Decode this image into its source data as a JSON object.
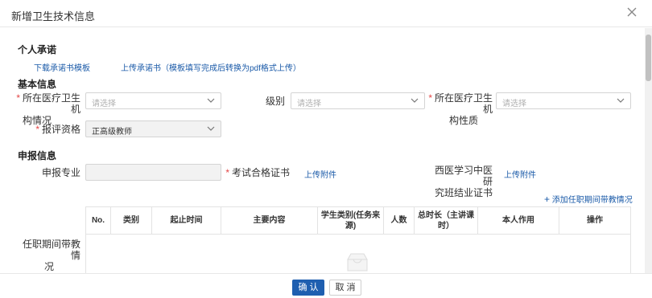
{
  "dialog": {
    "title": "新增卫生技术信息"
  },
  "personal": {
    "section": "个人承诺",
    "download_link": "下载承诺书模板",
    "upload_link": "上传承诺书（模板填写完成后转换为pdf格式上传）"
  },
  "basic": {
    "section": "基本信息",
    "institution_status": {
      "label_line1": "所在医疗卫生机",
      "label_line2": "构情况",
      "placeholder": "请选择"
    },
    "level": {
      "label": "级别",
      "placeholder": "请选择"
    },
    "institution_nature": {
      "label_line1": "所在医疗卫生机",
      "label_line2": "构性质",
      "placeholder": "请选择"
    },
    "qualification": {
      "label": "报评资格",
      "value": "正高级教师"
    }
  },
  "application": {
    "section": "申报信息",
    "major": {
      "label": "申报专业"
    },
    "exam_cert": {
      "label": "考试合格证书",
      "upload": "上传附件"
    },
    "western_cert": {
      "label_line1": "西医学习中医研",
      "label_line2": "究班结业证书",
      "upload": "上传附件"
    },
    "teaching": {
      "add_link": "添加任职期间带教情况",
      "label_line1": "任职期间带教情",
      "label_line2": "况",
      "columns": [
        "No.",
        "类别",
        "起止时间",
        "主要内容",
        "学生类别(任务来源)",
        "人数",
        "总时长（主讲课时）",
        "本人作用",
        "操作"
      ]
    }
  },
  "footer": {
    "confirm": "确 认",
    "cancel": "取 消"
  },
  "colors": {
    "primary": "#1f5fb0",
    "link": "#1a5aa8",
    "required": "#e34545"
  }
}
